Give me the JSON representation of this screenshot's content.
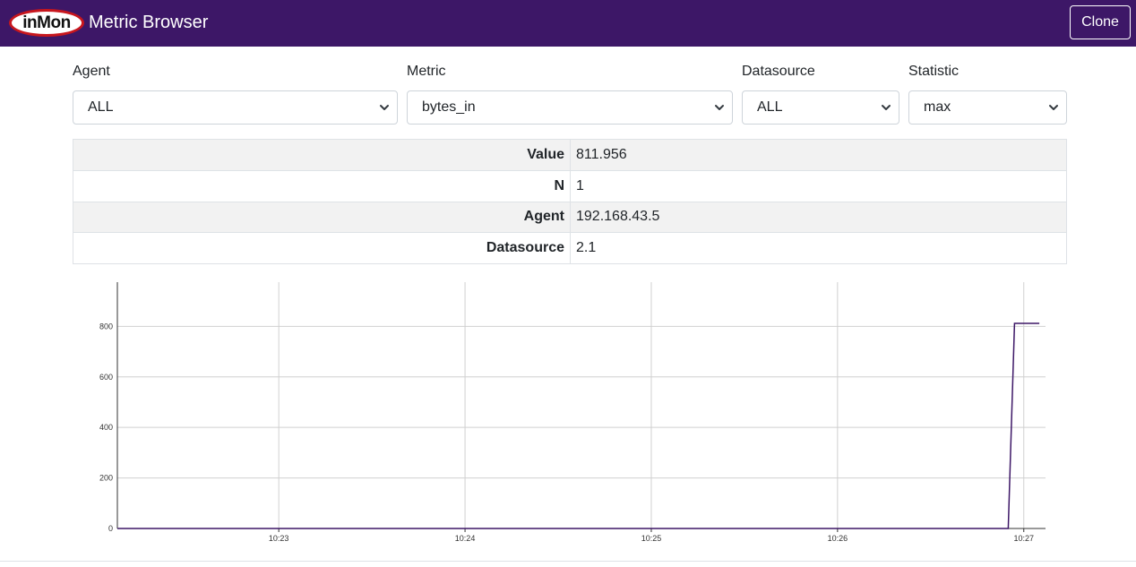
{
  "header": {
    "logo_text": "inMon",
    "title": "Metric Browser",
    "clone_label": "Clone",
    "bg_color": "#3d1767"
  },
  "filters": [
    {
      "label": "Agent",
      "selected": "ALL"
    },
    {
      "label": "Metric",
      "selected": "bytes_in"
    },
    {
      "label": "Datasource",
      "selected": "ALL"
    },
    {
      "label": "Statistic",
      "selected": "max"
    }
  ],
  "info_table": [
    {
      "key": "Value",
      "value": "811.956"
    },
    {
      "key": "N",
      "value": "1"
    },
    {
      "key": "Agent",
      "value": "192.168.43.5"
    },
    {
      "key": "Datasource",
      "value": "2.1"
    }
  ],
  "chart_data": {
    "type": "line",
    "title": "",
    "xlabel": "",
    "ylabel": "",
    "x_ticks": [
      "10:23",
      "10:24",
      "10:25",
      "10:26",
      "10:27"
    ],
    "y_ticks": [
      0,
      200,
      400,
      600,
      800
    ],
    "ylim": [
      0,
      975
    ],
    "grid": true,
    "line_color": "#3d1767",
    "series": [
      {
        "x": [
          "10:22:08",
          "10:26:55",
          "10:26:57",
          "10:27:05"
        ],
        "values": [
          0,
          0,
          811.956,
          811.956
        ]
      }
    ]
  }
}
